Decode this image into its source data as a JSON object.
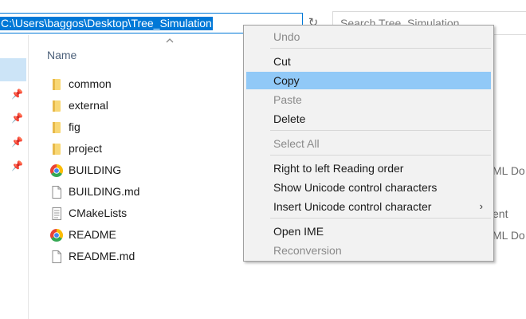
{
  "address_bar": {
    "path": "C:\\Users\\baggos\\Desktop\\Tree_Simulation"
  },
  "search": {
    "placeholder": "Search Tree_Simulation"
  },
  "column_header": {
    "name": "Name"
  },
  "files": [
    {
      "name": "common",
      "icon": "folder-icon"
    },
    {
      "name": "external",
      "icon": "folder-icon"
    },
    {
      "name": "fig",
      "icon": "folder-icon"
    },
    {
      "name": "project",
      "icon": "folder-icon"
    },
    {
      "name": "BUILDING",
      "icon": "chrome-html-icon"
    },
    {
      "name": "BUILDING.md",
      "icon": "document-icon"
    },
    {
      "name": "CMakeLists",
      "icon": "text-file-icon"
    },
    {
      "name": "README",
      "icon": "chrome-html-icon"
    },
    {
      "name": "README.md",
      "icon": "document-icon"
    }
  ],
  "type_fragments": [
    "ML Do...",
    "ent",
    "ML Do..."
  ],
  "context_menu": {
    "undo": "Undo",
    "cut": "Cut",
    "copy": "Copy",
    "paste": "Paste",
    "delete": "Delete",
    "select_all": "Select All",
    "rtl": "Right to left Reading order",
    "show_unicode": "Show Unicode control characters",
    "insert_unicode": "Insert Unicode control character",
    "open_ime": "Open IME",
    "reconversion": "Reconversion"
  },
  "colors": {
    "selection": "#0078d7",
    "menu_highlight": "#91c9f7",
    "nav_selected": "#cce4f7",
    "folder": "#f8d775"
  }
}
